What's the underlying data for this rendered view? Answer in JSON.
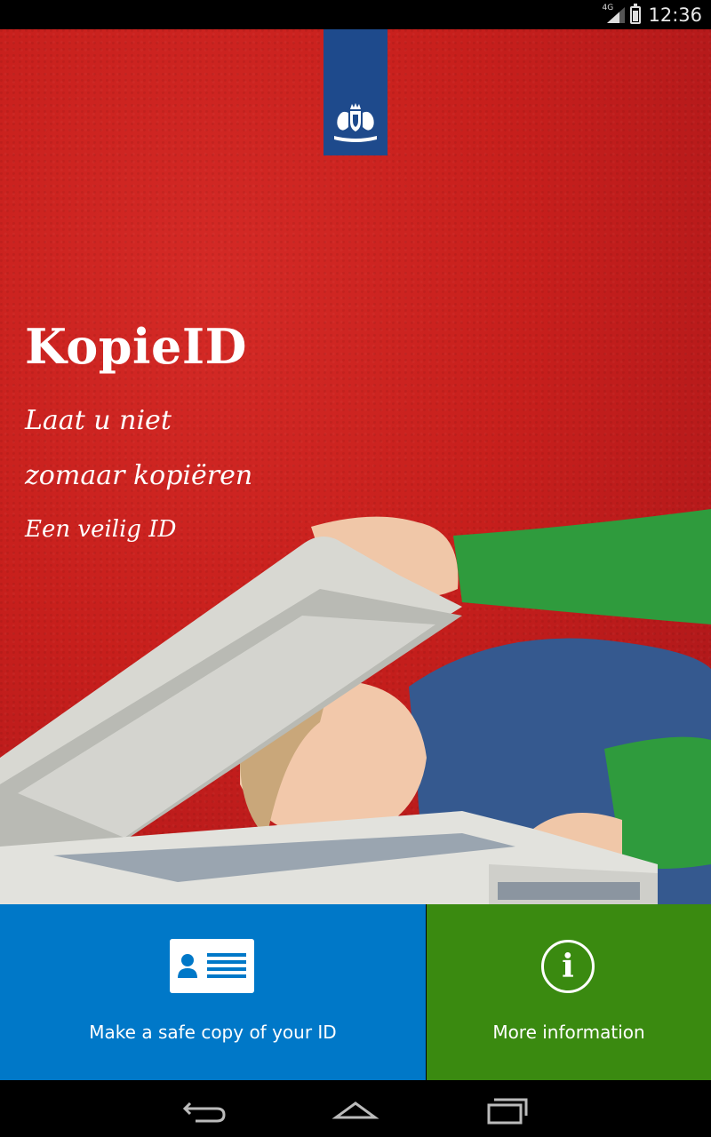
{
  "status_bar": {
    "network": "4G",
    "time": "12:36"
  },
  "hero": {
    "logo": "rijksoverheid-crest",
    "title": "KopieID",
    "tagline_line1": "Laat u niet",
    "tagline_line2": "zomaar kopiëren",
    "tagline_line3": "Een veilig ID"
  },
  "actions": {
    "copy": {
      "label": "Make a safe copy of your ID",
      "icon": "id-card-icon",
      "color": "#0078c8"
    },
    "info": {
      "label": "More information",
      "icon": "info-icon",
      "icon_glyph": "i",
      "color": "#3a8a10"
    }
  },
  "nav_bar": {
    "buttons": [
      "back-icon",
      "home-icon",
      "recents-icon"
    ]
  }
}
